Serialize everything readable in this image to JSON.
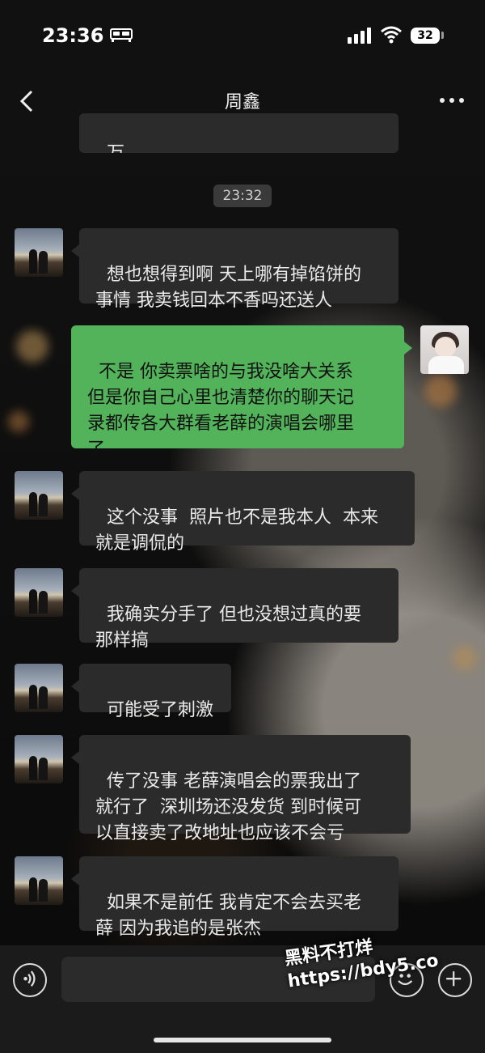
{
  "status_bar": {
    "time": "23:36",
    "battery": "32",
    "icons": [
      "bed-icon",
      "signal-icon",
      "wifi-icon",
      "battery-icon"
    ]
  },
  "header": {
    "title": "周鑫",
    "back_icon": "chevron-left-icon",
    "more_icon": "more-dots-icon"
  },
  "chat": {
    "partial_top_text": "万",
    "timestamp": "23:32",
    "messages": [
      {
        "side": "left",
        "text": "想也想得到啊 天上哪有掉馅饼的\n事情 我卖钱回本不香吗还送人"
      },
      {
        "side": "right",
        "text": "不是 你卖票啥的与我没啥大关系\n但是你自己心里也清楚你的聊天记\n录都传各大群看老薛的演唱会哪里\n了"
      },
      {
        "side": "left",
        "text": "这个没事  照片也不是我本人  本来\n就是调侃的"
      },
      {
        "side": "left",
        "text": "我确实分手了 但也没想过真的要\n那样搞"
      },
      {
        "side": "left",
        "text": "可能受了刺激"
      },
      {
        "side": "left",
        "text": "传了没事 老薛演唱会的票我出了\n就行了  深圳场还没发货 到时候可\n以直接卖了改地址也应该不会亏"
      },
      {
        "side": "left",
        "text": "如果不是前任 我肯定不会去买老\n薛 因为我追的是张杰"
      }
    ]
  },
  "input_bar": {
    "voice_icon": "voice-icon",
    "emoji_icon": "emoji-icon",
    "plus_icon": "plus-icon"
  },
  "watermark": {
    "line1": "黑料不打烊",
    "line2": "https://bdy5.co"
  }
}
